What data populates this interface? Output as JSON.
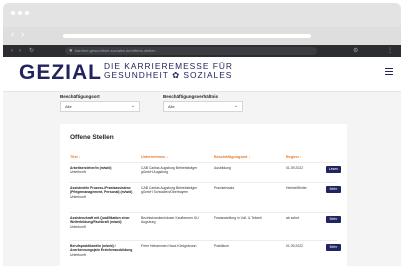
{
  "browser": {
    "url": "karriere.gesundheit-soziales.de/offene-stellen"
  },
  "brand": {
    "logo": "GEZIAL",
    "tagline_line1": "DIE KARRIEREMESSE FÜR",
    "tagline_line2": "GESUNDHEIT ✿ SOZIALES",
    "color": "#21245e",
    "accent": "#e8792a"
  },
  "filters": {
    "location_label": "Beschäftigungsort",
    "location_value": "Alle",
    "relation_label": "Beschäftigungsverhältnis",
    "relation_value": "Alle"
  },
  "jobs": {
    "title": "Offene Stellen",
    "columns": [
      "Titel ↓",
      "Unternehmen ↓",
      "Beschäftigungsart ↓",
      "Beginn ↓"
    ],
    "rows": [
      {
        "title": "Arbeitserzieher/in (m/w/d)",
        "title_sub": "Unterkunft",
        "company": "CAB Caritas Augsburg Betriebsträger gGmbH Augsburg",
        "type": "Ausbildung",
        "start": "01.09.2022",
        "button": "Lesen"
      },
      {
        "title": "Assistent/in Prozess-/Praxisassistenz (Pflegemanagement, Personal) (m/w/d)",
        "title_sub": "Unterkunft",
        "company": "CAB Caritas Augsburg Betriebsträger gGmbH Schwaben/Oberbayern",
        "type": "Praxiseinsatz",
        "start": "Herbst/Winter",
        "button": "Mehr"
      },
      {
        "title": "Assistenzkraft mit Qualifikation einer Weiterbildung/Fachkraft (m/w/d)",
        "title_sub": "Unterkunft",
        "company": "Bezirkskrankenhäuser Kaufbeuren KU Augsburg",
        "type": "Festanstellung in Voll- & Teilzeit",
        "start": "ab sofort",
        "button": "Mehr"
      },
      {
        "title": "Berufspraktikant/in (m/w/d) / Anerkennungsjahr Erzieherausbildung",
        "title_sub": "Unterkunft",
        "company": "Frère Hebammen Haus Königsbrunn",
        "type": "Praktikum",
        "start": "01.09.2022",
        "button": "Mehr"
      }
    ]
  }
}
